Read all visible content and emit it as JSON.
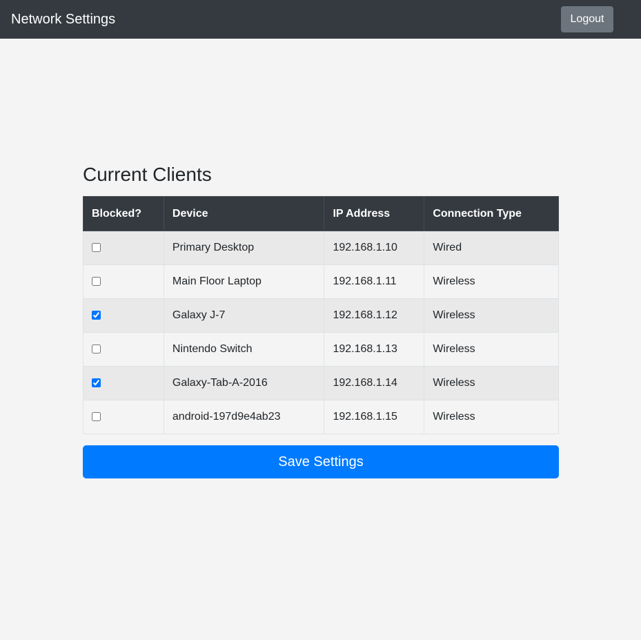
{
  "navbar": {
    "brand": "Network Settings",
    "logout_label": "Logout"
  },
  "main": {
    "title": "Current Clients",
    "table": {
      "headers": {
        "blocked": "Blocked?",
        "device": "Device",
        "ip": "IP Address",
        "connection": "Connection Type"
      },
      "rows": [
        {
          "blocked": false,
          "device": "Primary Desktop",
          "ip": "192.168.1.10",
          "connection": "Wired"
        },
        {
          "blocked": false,
          "device": "Main Floor Laptop",
          "ip": "192.168.1.11",
          "connection": "Wireless"
        },
        {
          "blocked": true,
          "device": "Galaxy J-7",
          "ip": "192.168.1.12",
          "connection": "Wireless"
        },
        {
          "blocked": false,
          "device": "Nintendo Switch",
          "ip": "192.168.1.13",
          "connection": "Wireless"
        },
        {
          "blocked": true,
          "device": "Galaxy-Tab-A-2016",
          "ip": "192.168.1.14",
          "connection": "Wireless"
        },
        {
          "blocked": false,
          "device": "android-197d9e4ab23",
          "ip": "192.168.1.15",
          "connection": "Wireless"
        }
      ]
    },
    "save_label": "Save Settings"
  },
  "colors": {
    "navbar_bg": "#343a40",
    "logout_bg": "#6c757d",
    "primary": "#007bff",
    "page_bg": "#f4f4f4"
  }
}
